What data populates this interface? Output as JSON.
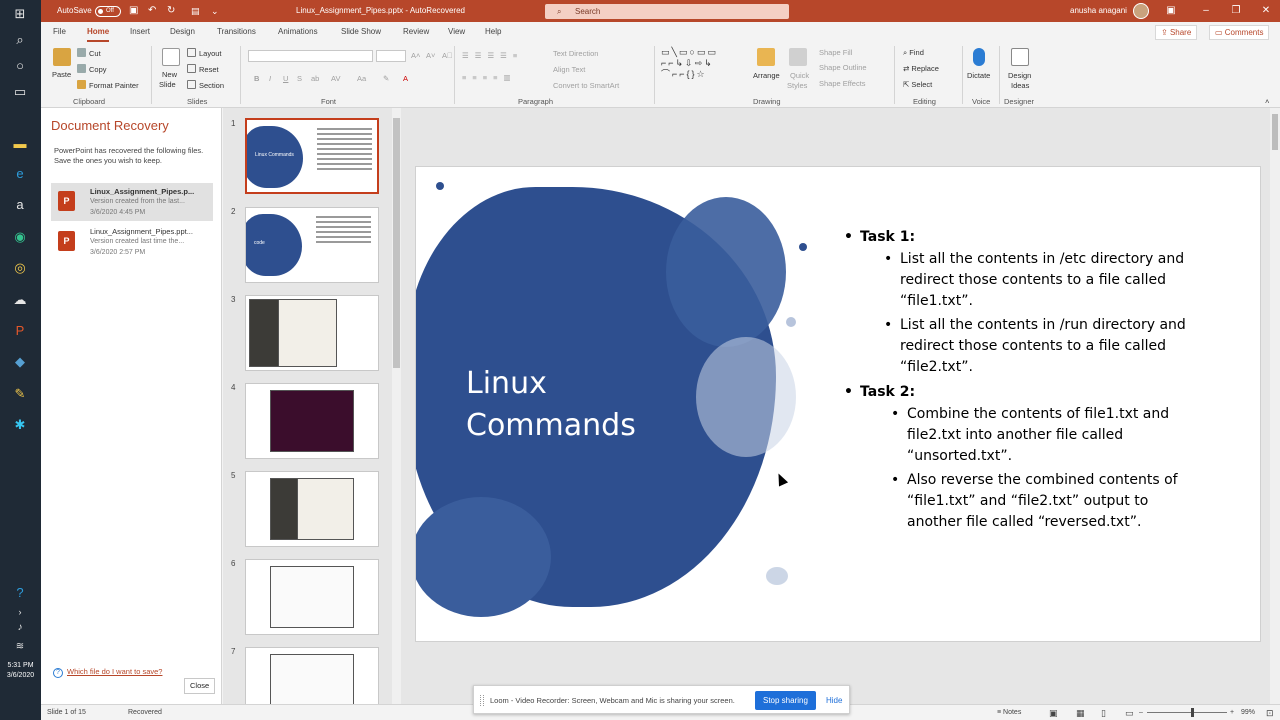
{
  "taskbar": {
    "icons": [
      "windows-icon",
      "search-icon",
      "cortana-icon",
      "task-view-icon",
      "file-explorer-icon",
      "edge-icon",
      "amazon-icon",
      "tripadvisor-icon",
      "chrome-icon",
      "onedrive-icon",
      "powerpoint-icon",
      "virtualbox-icon",
      "tool-icon",
      "slack-icon"
    ],
    "time": "5:31 PM",
    "date": "3/6/2020"
  },
  "titlebar": {
    "autosave_label": "AutoSave",
    "autosave_state": "Off",
    "document_title": "Linux_Assignment_Pipes.pptx  -  AutoRecovered",
    "search_placeholder": "Search",
    "user_name": "anusha anagani"
  },
  "menu": {
    "tabs": [
      "File",
      "Home",
      "Insert",
      "Design",
      "Transitions",
      "Animations",
      "Slide Show",
      "Review",
      "View",
      "Help"
    ],
    "active": "Home",
    "share": "Share",
    "comments": "Comments"
  },
  "ribbon": {
    "clipboard": {
      "paste": "Paste",
      "cut": "Cut",
      "copy": "Copy",
      "format_painter": "Format Painter",
      "label": "Clipboard"
    },
    "slides": {
      "new_slide": "New",
      "new_slide2": "Slide",
      "layout": "Layout",
      "reset": "Reset",
      "section": "Section",
      "label": "Slides"
    },
    "font": {
      "bold": "B",
      "italic": "I",
      "underline": "U",
      "strike": "S",
      "shadow": "ab",
      "spacing": "AV",
      "case": "Aa",
      "label": "Font"
    },
    "paragraph": {
      "text_direction": "Text Direction",
      "align_text": "Align Text",
      "smartart": "Convert to SmartArt",
      "label": "Paragraph"
    },
    "drawing": {
      "arrange": "Arrange",
      "quick_styles": "Quick",
      "quick_styles2": "Styles",
      "shape_fill": "Shape Fill",
      "shape_outline": "Shape Outline",
      "shape_effects": "Shape Effects",
      "label": "Drawing"
    },
    "editing": {
      "find": "Find",
      "replace": "Replace",
      "select": "Select",
      "label": "Editing"
    },
    "voice": {
      "dictate": "Dictate",
      "label": "Voice"
    },
    "designer": {
      "design_ideas": "Design",
      "design_ideas2": "Ideas",
      "label": "Designer"
    }
  },
  "recovery": {
    "title": "Document Recovery",
    "description": "PowerPoint has recovered the following files.  Save the ones you wish to keep.",
    "files": [
      {
        "name": "Linux_Assignment_Pipes.p...",
        "desc": "Version created from the last...",
        "date": "3/6/2020 4:45 PM"
      },
      {
        "name": "Linux_Assignment_Pipes.ppt...",
        "desc": "Version created last time the...",
        "date": "3/6/2020 2:57 PM"
      }
    ],
    "help_link": "Which file do I want to save?",
    "close": "Close"
  },
  "thumbnails": {
    "numbers": [
      "1",
      "2",
      "3",
      "4",
      "5",
      "6",
      "7"
    ],
    "slide1_title": "Linux Commands",
    "slide2_title": "code"
  },
  "slide": {
    "title_line1": "Linux",
    "title_line2": "Commands",
    "task1": "Task 1:",
    "task1_items": [
      "List all the contents in /etc directory and redirect those contents to a file called “file1.txt”.",
      "List all the contents in /run directory and redirect those contents to a file called “file2.txt”."
    ],
    "task2": "Task 2:",
    "task2_items": [
      "Combine the contents of file1.txt and file2.txt into another file called “unsorted.txt”.",
      "Also reverse the combined contents of “file1.txt” and “file2.txt” output to another file called “reversed.txt”."
    ]
  },
  "loom": {
    "message": "Loom - Video Recorder: Screen, Webcam and Mic is sharing your screen.",
    "stop": "Stop sharing",
    "hide": "Hide"
  },
  "statusbar": {
    "slide_count": "Slide 1 of 15",
    "status": "Recovered",
    "notes": "Notes",
    "zoom": "99%"
  },
  "colors": {
    "accent": "#b7472a",
    "blob": "#2e4f8f"
  }
}
